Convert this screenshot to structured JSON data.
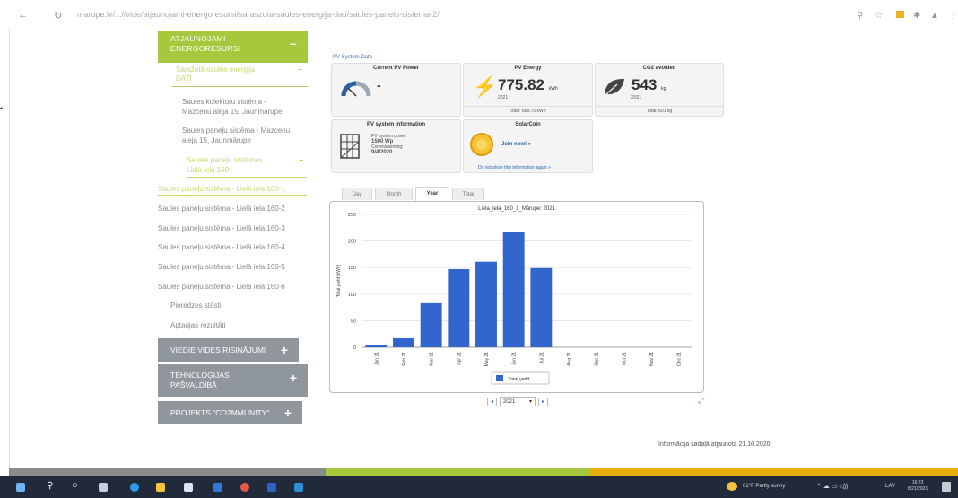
{
  "browser": {
    "url": "marupe.lv/...//vide/atjaunojami-energoresursi/saraszota-saules-energija-dati/saules-panelu-sistema-2/"
  },
  "sidebar": {
    "atjaunojami_l1": "ATJAUNOJAMI",
    "atjaunojami_l2": "ENERGORESURSI",
    "saraz_l1": "Saražotā saules enerģija",
    "saraz_l2": "DATI",
    "kolektoru_l1": "Saules kolektoru sistēma -",
    "kolektoru_l2": "Mazcenu aleja 15, Jaunmārupe",
    "panelu_l1": "Saules paneļu sistēma - Mazcenu",
    "panelu_l2": "aleja 15, Jaunmārupe",
    "panelu2_l1": "Saules paneļu sistēmas -",
    "panelu2_l2": "Lielā iela 160",
    "levels": [
      "Saules paneļu sistēma - Lielā iela 160-1",
      "Saules paneļu sistēma - Lielā iela 160-2",
      "Saules paneļu sistēma - Lielā iela 160-3",
      "Saules paneļu sistēma - Lielā iela 160-4",
      "Saules paneļu sistēma - Lielā iela 160-5",
      "Saules paneļu sistēma - Lielā iela 160-6"
    ],
    "pieredzes": "Pieredzes stāsti",
    "aptaujas": "Aptaujas rezultāti",
    "viedie": "VIEDIE VIDES RISINĀJUMI",
    "tehno_l1": "TEHNOLOĢIJAS",
    "tehno_l2": "PAŠVALDĪBĀ",
    "projekts": "PROJEKTS \"CO2MMUNITY\""
  },
  "pv": {
    "section_title": "PV System Data",
    "current_power_title": "Current PV Power",
    "current_power_value": "-",
    "energy_title": "PV Energy",
    "energy_value": "775.82",
    "energy_unit": "kWh",
    "energy_year": "2021",
    "energy_total": "Total: 858.70 kWh",
    "co2_title": "CO2 avoided",
    "co2_value": "543",
    "co2_unit": "kg",
    "co2_year": "2021",
    "co2_total": "Total: 601 kg",
    "info_title": "PV system information",
    "info_power_label": "PV system power:",
    "info_power_value": "1500 Wp",
    "info_comm_label": "Commissioning:",
    "info_comm_value": "9/4/2020",
    "solarcoin_title": "SolarCoin",
    "solarcoin_join": "Join now! »",
    "solarcoin_hide": "Do not show this information again »"
  },
  "tabs": [
    "Day",
    "Month",
    "Year",
    "Total"
  ],
  "active_tab": "Year",
  "chart_data": {
    "type": "bar",
    "title": "Liela_iela_160_1_Mārupe: 2021",
    "ylabel": "Total yield [kWh]",
    "xlabel": "",
    "categories": [
      "Jan 21",
      "Feb 21",
      "Mar 21",
      "Apr 21",
      "May 21",
      "Jun 21",
      "Jul 21",
      "Aug 21",
      "Sep 21",
      "Oct 21",
      "Nov 21",
      "Dec 21"
    ],
    "values": [
      4,
      17,
      83,
      147,
      161,
      217,
      149,
      0,
      0,
      0,
      0,
      0
    ],
    "yticks": [
      0,
      50,
      100,
      150,
      200,
      250
    ],
    "ylim": [
      0,
      250
    ],
    "legend": "Total yield",
    "legend_position": "bottom",
    "bar_color": "#3366cc",
    "grid": true
  },
  "year_select": "2021",
  "footer_info": "Informācija sadaļā atjaunota 21.10.2020.",
  "taskbar": {
    "weather": "61°F  Partly sunny",
    "lang": "LAV",
    "time": "16:23",
    "date": "8/21/2021"
  }
}
